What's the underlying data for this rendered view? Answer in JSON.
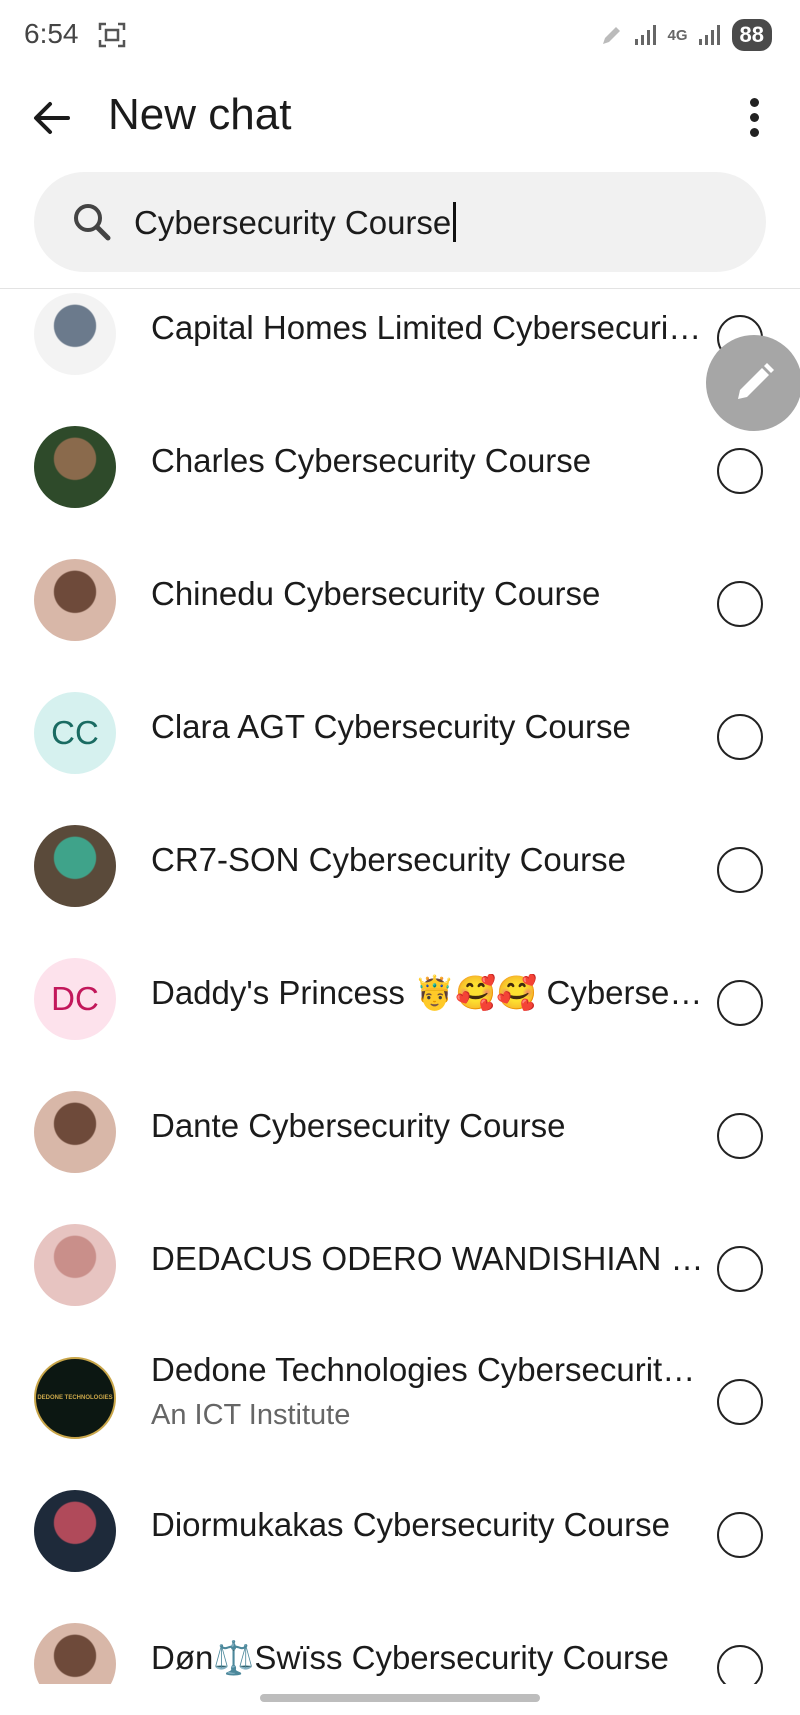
{
  "status_bar": {
    "time": "6:54",
    "network": "4G",
    "battery": "88"
  },
  "header": {
    "title": "New chat"
  },
  "search": {
    "value": "Cybersecurity Course"
  },
  "contacts": [
    {
      "name": "Capital Homes Limited Cybersecurity Course",
      "subtitle": "",
      "avatar_type": "photo",
      "avatar_desc": "house-photo",
      "initials": ""
    },
    {
      "name": "Charles Cybersecurity Course",
      "subtitle": "",
      "avatar_type": "photo",
      "avatar_desc": "earth-is-ghetto-photo",
      "initials": ""
    },
    {
      "name": "Chinedu Cybersecurity Course",
      "subtitle": "",
      "avatar_type": "photo",
      "avatar_desc": "portrait-photo",
      "initials": ""
    },
    {
      "name": "Clara AGT Cybersecurity Course",
      "subtitle": "",
      "avatar_type": "initials",
      "initials": "CC",
      "color_bg": "#d6f1ef",
      "color_fg": "#1a6b62"
    },
    {
      "name": "CR7-SON Cybersecurity Course",
      "subtitle": "",
      "avatar_type": "photo",
      "avatar_desc": "dancer-photo",
      "initials": ""
    },
    {
      "name": "Daddy's Princess 🤴🥰🥰 Cybersecurity Course",
      "subtitle": "",
      "avatar_type": "initials",
      "initials": "DC",
      "color_bg": "#fde2ec",
      "color_fg": "#c2185b"
    },
    {
      "name": "Dante Cybersecurity Course",
      "subtitle": "",
      "avatar_type": "photo",
      "avatar_desc": "portrait-photo",
      "initials": ""
    },
    {
      "name": "DEDACUS ODERO WANDISHIAN Cybersecurity Course",
      "subtitle": "",
      "avatar_type": "photo",
      "avatar_desc": "pink-fabric-photo",
      "initials": ""
    },
    {
      "name": "Dedone Technologies Cybersecurity Course",
      "subtitle": "An ICT Institute",
      "avatar_type": "logo",
      "avatar_desc": "dedone-logo",
      "initials": "",
      "logo_text": "DEDONE TECHNOLOGIES"
    },
    {
      "name": "Diormukakas Cybersecurity Course",
      "subtitle": "",
      "avatar_type": "photo",
      "avatar_desc": "dark-portrait-photo",
      "initials": ""
    },
    {
      "name": "Døn⚖️Swïss Cybersecurity Course",
      "subtitle": "",
      "avatar_type": "photo",
      "avatar_desc": "portrait-photo",
      "initials": ""
    }
  ]
}
